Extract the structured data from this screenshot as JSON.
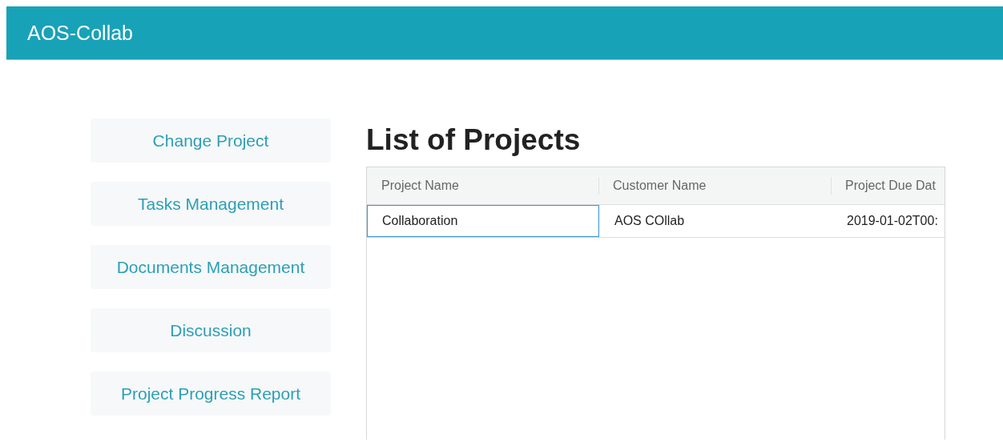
{
  "app_bar": {
    "title": "AOS-Collab"
  },
  "sidebar": {
    "items": [
      {
        "label": "Change Project"
      },
      {
        "label": "Tasks Management"
      },
      {
        "label": "Documents Management"
      },
      {
        "label": "Discussion"
      },
      {
        "label": "Project Progress Report"
      }
    ]
  },
  "page_title": "List of Projects",
  "table": {
    "columns": [
      "Project Name",
      "Customer Name",
      "Project Due Dat"
    ],
    "rows": [
      {
        "cells": [
          {
            "text": "Collaboration",
            "selected": true
          },
          {
            "text": "AOS COllab",
            "selected": false
          },
          {
            "text": "2019-01-02T00:",
            "selected": false
          }
        ]
      }
    ]
  }
}
